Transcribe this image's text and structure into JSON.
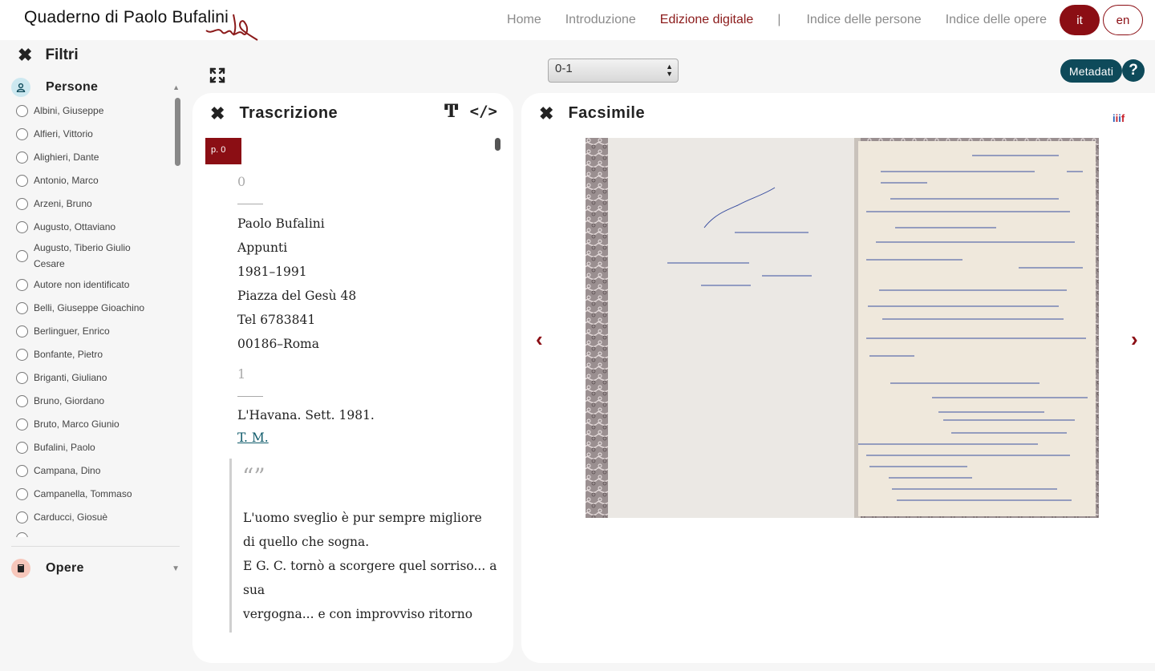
{
  "header": {
    "logo_text": "Quaderno di Paolo Bufalini",
    "nav": {
      "home": "Home",
      "intro": "Introduzione",
      "digital": "Edizione digitale",
      "separator": "|",
      "persons_index": "Indice delle persone",
      "works_index": "Indice delle opere"
    },
    "lang_it": "it",
    "lang_en": "en",
    "accent_color": "#8b0e14"
  },
  "sidebar": {
    "title": "Filtri",
    "persons_label": "Persone",
    "works_label": "Opere",
    "persons": [
      "Albini, Giuseppe",
      "Alfieri, Vittorio",
      "Alighieri, Dante",
      "Antonio, Marco",
      "Arzeni, Bruno",
      "Augusto, Ottaviano",
      "Augusto, Tiberio Giulio Cesare",
      "Autore non identificato",
      "Belli, Giuseppe Gioachino",
      "Berlinguer, Enrico",
      "Bonfante, Pietro",
      "Briganti, Giuliano",
      "Bruno, Giordano",
      "Bruto, Marco Giunio",
      "Bufalini, Paolo",
      "Campana, Dino",
      "Campanella, Tommaso",
      "Carducci, Giosuè"
    ]
  },
  "toolbar": {
    "page_select": "0-1",
    "metadata_label": "Metadati",
    "help_label": "?"
  },
  "transcription": {
    "title": "Trascrizione",
    "page_badge": "p. 0",
    "page0_num": "0",
    "lines0": [
      "Paolo Bufalini",
      "Appunti",
      "1981–1991",
      "Piazza del Gesù 48",
      "Tel 6783841",
      "00186–Roma"
    ],
    "page1_num": "1",
    "lines1": [
      "L'Havana. Sett. 1981."
    ],
    "link": "T. M.",
    "quote_mark": "“”",
    "quote": [
      "L'uomo sveglio è pur sempre migliore",
      "di quello che sogna.",
      "E G. C. tornò a scorgere quel sorriso... a",
      "sua",
      "vergogna... e con improvviso ritorno"
    ]
  },
  "facsimile": {
    "title": "Facsimile",
    "iiif_label": "iiif",
    "prev_glyph": "‹",
    "next_glyph": "›"
  }
}
